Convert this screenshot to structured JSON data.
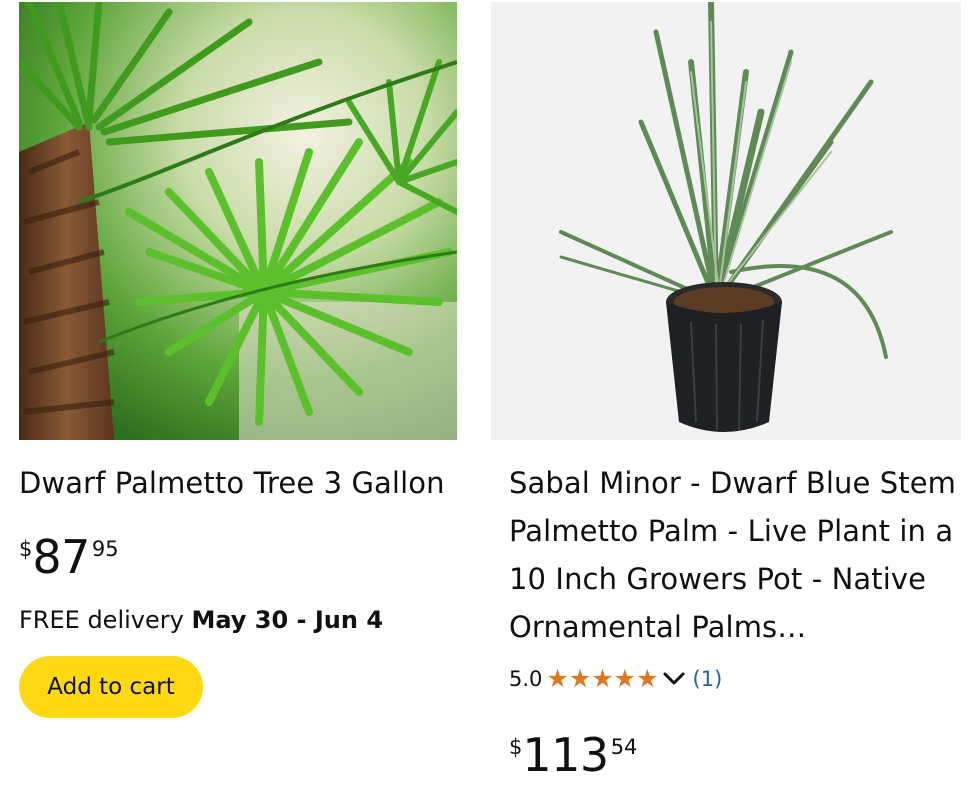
{
  "products": [
    {
      "title": "Dwarf Palmetto Tree 3 Gallon",
      "price": {
        "symbol": "$",
        "whole": "87",
        "fraction": "95"
      },
      "delivery": {
        "prefix": "FREE delivery ",
        "dates": "May 30 - Jun 4"
      },
      "button_label": "Add to cart"
    },
    {
      "title": "Sabal Minor - Dwarf Blue Stem Palmetto Palm - Live Plant in a 10 Inch Growers Pot - Native Ornamental Palms…",
      "rating": {
        "score": "5.0",
        "stars": 5,
        "count": "(1)"
      },
      "price": {
        "symbol": "$",
        "whole": "113",
        "fraction": "54"
      }
    }
  ],
  "colors": {
    "button_yellow": "#ffd814",
    "star_orange": "#de7921",
    "link_blue": "#2162a1",
    "text": "#0f1111"
  },
  "icons": [
    "star-icon",
    "chevron-down-icon"
  ]
}
